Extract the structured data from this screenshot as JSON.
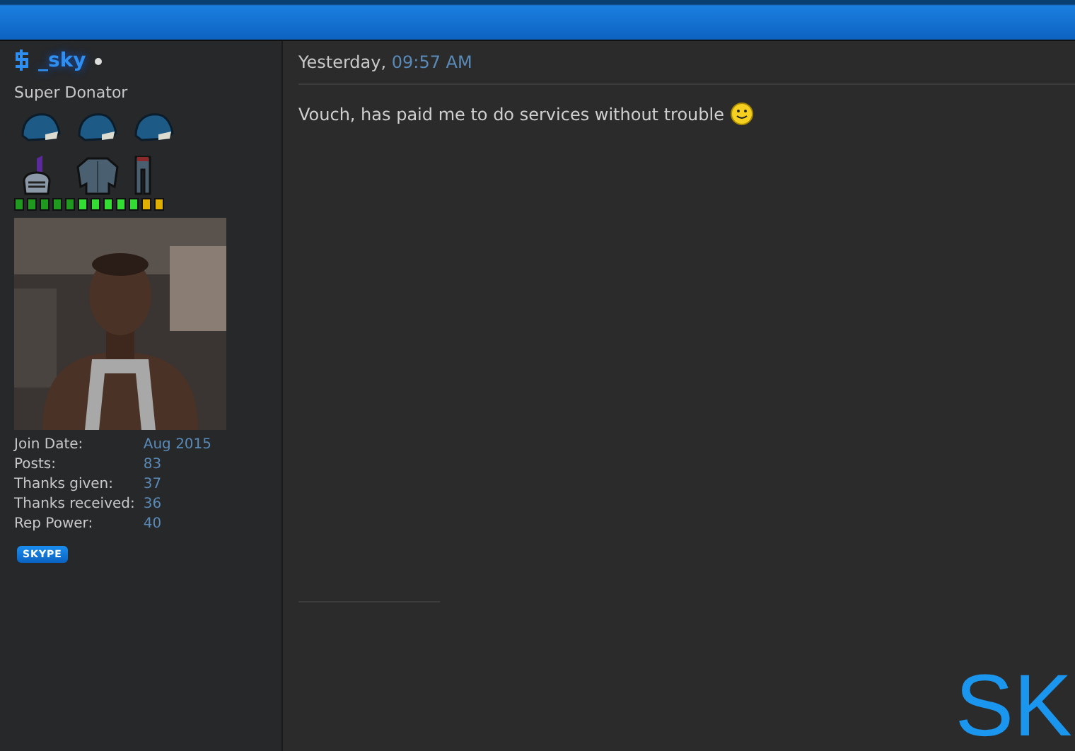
{
  "user": {
    "username": "_sky",
    "online": true,
    "title": "Super Donator",
    "rep_pips": [
      {
        "color": "#1f9a1f"
      },
      {
        "color": "#1f9a1f"
      },
      {
        "color": "#1f9a1f"
      },
      {
        "color": "#1f9a1f"
      },
      {
        "color": "#1f9a1f"
      },
      {
        "color": "#33dd33"
      },
      {
        "color": "#33dd33"
      },
      {
        "color": "#33dd33"
      },
      {
        "color": "#33dd33"
      },
      {
        "color": "#33dd33"
      },
      {
        "color": "#e0b000"
      },
      {
        "color": "#e0b000"
      }
    ],
    "stats": [
      {
        "label": "Join Date:",
        "value": "Aug 2015"
      },
      {
        "label": "Posts:",
        "value": "83"
      },
      {
        "label": "Thanks given:",
        "value": "37"
      },
      {
        "label": "Thanks received:",
        "value": "36"
      },
      {
        "label": "Rep Power:",
        "value": "40"
      }
    ],
    "contact_badge": "SKYPE"
  },
  "post": {
    "date": "Yesterday,",
    "time": "09:57 AM",
    "message": "Vouch, has paid me to do services without trouble",
    "signature_logo": "SK"
  }
}
